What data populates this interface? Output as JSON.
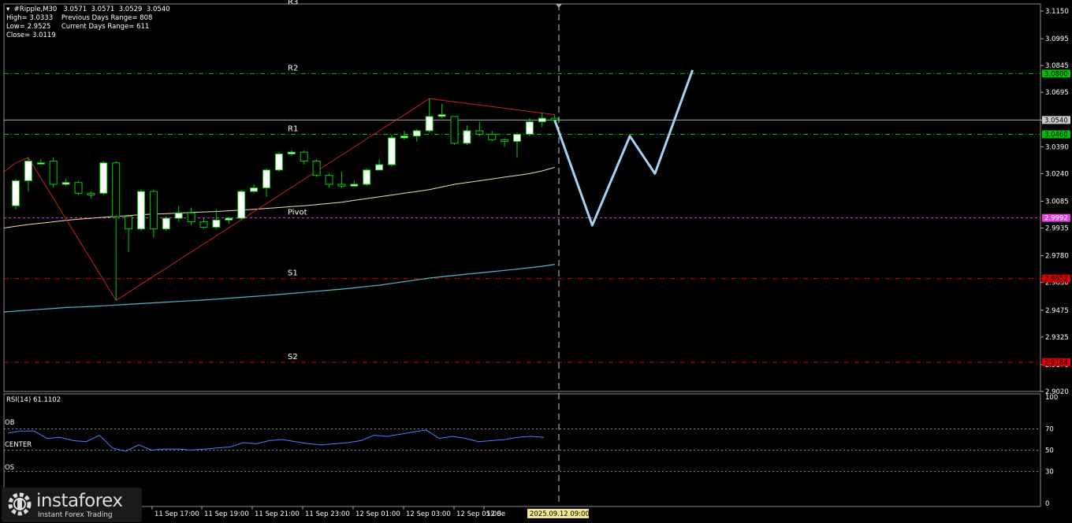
{
  "header": {
    "line1": "▾  #Ripple,M30   3.0571  3.0571  3.0529  3.0540",
    "line2": "High= 3.0333    Previous Days Range= 808",
    "line3": "Low= 2.9525     Current Days Range= 611",
    "line4": "Close= 3.0119"
  },
  "rsi": {
    "label": "RSI(14) 61.1102",
    "ob_label": "OB",
    "center_label": "CENTER",
    "os_label": "OS",
    "levels": [
      100,
      70,
      50,
      30,
      0
    ],
    "values": [
      66,
      68,
      68,
      61,
      62,
      59,
      58,
      64,
      52,
      49,
      55,
      50,
      51,
      51,
      50,
      51,
      52,
      53,
      57,
      56,
      59,
      60,
      58,
      56,
      55,
      56,
      57,
      59,
      64,
      63,
      65,
      67,
      69,
      61,
      63,
      61,
      58,
      59,
      60,
      62,
      63,
      62
    ]
  },
  "logo": {
    "name": "instaforex",
    "tagline": "Instant Forex Trading"
  },
  "chart_data": {
    "type": "candlestick",
    "symbol": "#Ripple",
    "timeframe": "M30",
    "y_ticks": [
      "3.1150",
      "3.0995",
      "3.0845",
      "3.0695",
      "3.0540",
      "3.0390",
      "3.0240",
      "3.0085",
      "2.9935",
      "2.9780",
      "2.9630",
      "2.9475",
      "2.9325",
      "2.9170",
      "2.9020"
    ],
    "ylim": [
      2.902,
      3.119
    ],
    "x_ticks": [
      "11 Sep 17:00",
      "11 Sep 19:00",
      "11 Sep 21:00",
      "11 Sep 23:00",
      "12 Sep 01:00",
      "12 Sep 03:00",
      "12 Sep 05:00",
      "12 Se"
    ],
    "x_highlight": "2025.09.12 09:00",
    "current_price": {
      "value": 3.054,
      "label": "3.0540"
    },
    "levels": [
      {
        "name": "R3",
        "value": 3.117,
        "label": "",
        "color": "#00c000",
        "style": "none"
      },
      {
        "name": "R2",
        "value": 3.08,
        "label": "3.0800",
        "color": "#00c000",
        "style": "dashdot"
      },
      {
        "name": "R1",
        "value": 3.046,
        "label": "3.0460",
        "color": "#00c000",
        "style": "dashdot"
      },
      {
        "name": "Pivot",
        "value": 2.9992,
        "label": "2.9992",
        "color": "#e040e0",
        "style": "dashed"
      },
      {
        "name": "S1",
        "value": 2.9652,
        "label": "2.9652",
        "color": "#e00000",
        "style": "dashdot"
      },
      {
        "name": "S2",
        "value": 2.9184,
        "label": "2.9184",
        "color": "#e00000",
        "style": "dashdot"
      }
    ],
    "candles": [
      [
        3.006,
        3.02,
        3.004,
        3.021
      ],
      [
        3.02,
        3.031,
        3.014,
        3.033
      ],
      [
        3.03,
        3.03,
        3.03,
        3.032
      ],
      [
        3.031,
        3.018,
        3.016,
        3.033
      ],
      [
        3.018,
        3.019,
        3.017,
        3.021
      ],
      [
        3.019,
        3.013,
        3.012,
        3.02
      ],
      [
        3.013,
        3.012,
        3.01,
        3.014
      ],
      [
        3.013,
        3.03,
        3.012,
        3.031
      ],
      [
        3.03,
        3.0,
        2.953,
        3.031
      ],
      [
        3.0,
        2.993,
        2.98,
        3.001
      ],
      [
        2.993,
        3.014,
        2.992,
        3.015
      ],
      [
        3.014,
        2.993,
        2.988,
        3.015
      ],
      [
        2.993,
        2.999,
        2.992,
        3.0
      ],
      [
        2.999,
        3.002,
        2.997,
        3.006
      ],
      [
        3.002,
        2.997,
        2.995,
        3.005
      ],
      [
        2.997,
        2.994,
        2.993,
        2.999
      ],
      [
        2.994,
        2.998,
        2.993,
        3.004
      ],
      [
        2.998,
        2.999,
        2.996,
        3.0
      ],
      [
        2.999,
        3.014,
        2.998,
        3.015
      ],
      [
        3.014,
        3.016,
        3.013,
        3.018
      ],
      [
        3.016,
        3.026,
        3.011,
        3.027
      ],
      [
        3.026,
        3.035,
        3.025,
        3.036
      ],
      [
        3.035,
        3.036,
        3.034,
        3.037
      ],
      [
        3.036,
        3.031,
        3.029,
        3.037
      ],
      [
        3.031,
        3.023,
        3.022,
        3.032
      ],
      [
        3.023,
        3.018,
        3.016,
        3.024
      ],
      [
        3.018,
        3.017,
        3.016,
        3.025
      ],
      [
        3.017,
        3.018,
        3.017,
        3.02
      ],
      [
        3.018,
        3.026,
        3.017,
        3.027
      ],
      [
        3.026,
        3.029,
        3.026,
        3.032
      ],
      [
        3.029,
        3.044,
        3.028,
        3.046
      ],
      [
        3.044,
        3.045,
        3.043,
        3.048
      ],
      [
        3.045,
        3.048,
        3.042,
        3.049
      ],
      [
        3.048,
        3.056,
        3.047,
        3.066
      ],
      [
        3.056,
        3.057,
        3.055,
        3.063
      ],
      [
        3.056,
        3.041,
        3.04,
        3.056
      ],
      [
        3.041,
        3.048,
        3.04,
        3.051
      ],
      [
        3.048,
        3.046,
        3.045,
        3.053
      ],
      [
        3.046,
        3.043,
        3.042,
        3.048
      ],
      [
        3.043,
        3.042,
        3.039,
        3.044
      ],
      [
        3.042,
        3.046,
        3.033,
        3.047
      ],
      [
        3.046,
        3.053,
        3.045,
        3.055
      ],
      [
        3.053,
        3.055,
        3.05,
        3.058
      ],
      [
        3.055,
        3.054,
        3.052,
        3.057
      ]
    ],
    "ma_fast": [
      2.9945,
      2.9955,
      2.9962,
      2.997,
      2.9978,
      2.9985,
      2.999,
      2.9995,
      3.0,
      3.0005,
      3.001,
      3.0013,
      3.0016,
      3.0019,
      3.0022,
      3.0025,
      3.0028,
      3.0032,
      3.0036,
      3.004,
      3.0045,
      3.005,
      3.0055,
      3.006,
      3.0066,
      3.0073,
      3.008,
      3.009,
      3.01,
      3.011,
      3.012,
      3.013,
      3.014,
      3.015,
      3.0165,
      3.018,
      3.019,
      3.02,
      3.021,
      3.022,
      3.023,
      3.024,
      3.0255,
      3.0275
    ],
    "ma_slow": [
      2.947,
      2.9475,
      2.948,
      2.9485,
      2.949,
      2.9493,
      2.9496,
      2.95,
      2.9504,
      2.9508,
      2.9512,
      2.9516,
      2.952,
      2.9524,
      2.9528,
      2.9532,
      2.9537,
      2.9542,
      2.9547,
      2.9552,
      2.9557,
      2.9563,
      2.9569,
      2.9575,
      2.9581,
      2.9587,
      2.9593,
      2.96,
      2.9608,
      2.9615,
      2.9625,
      2.9635,
      2.9645,
      2.9655,
      2.9662,
      2.967,
      2.9677,
      2.9684,
      2.9691,
      2.9698,
      2.9705,
      2.9713,
      2.9721,
      2.9732
    ],
    "zigzag": [
      [
        0,
        3.03
      ],
      [
        1,
        3.033
      ],
      [
        8,
        2.953
      ],
      [
        33,
        3.066
      ],
      [
        43,
        3.057
      ]
    ],
    "forecast": [
      [
        43,
        3.054
      ],
      [
        46,
        2.995
      ],
      [
        49,
        3.045
      ],
      [
        51,
        3.024
      ],
      [
        54,
        3.082
      ]
    ]
  }
}
